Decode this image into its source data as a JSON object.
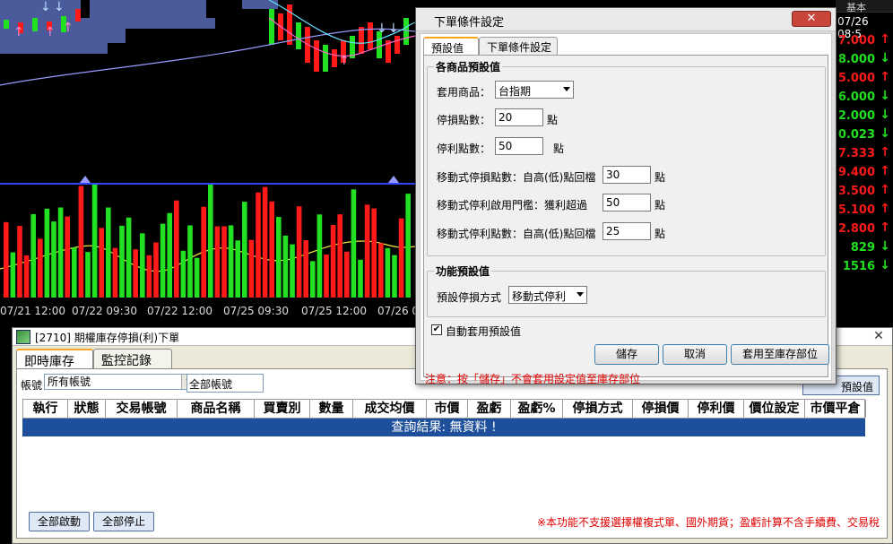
{
  "chart": {
    "time_labels": [
      "07/21 12:00",
      "07/22 09:30",
      "07/22 12:00",
      "07/25 09:30",
      "07/25 12:00",
      "07/26 0"
    ],
    "colors": {
      "up": "#ff1a1a",
      "down": "#22e022",
      "ma1": "#f5e642",
      "ma2": "#ff66cc",
      "ma3": "#66e0ff",
      "ma4": "#9999ff",
      "band": "#4a5a9a",
      "baseline": "#3344ff"
    }
  },
  "quotes": {
    "header": "基本",
    "time": "07/26 08:5",
    "rows": [
      {
        "value": "7.000",
        "dir": "up"
      },
      {
        "value": "8.000",
        "dir": "down"
      },
      {
        "value": "5.000",
        "dir": "up"
      },
      {
        "value": "6.000",
        "dir": "down"
      },
      {
        "value": "2.000",
        "dir": "down"
      },
      {
        "value": "0.023",
        "dir": "down"
      },
      {
        "value": "7.333",
        "dir": "up"
      },
      {
        "value": "9.400",
        "dir": "up"
      },
      {
        "value": "3.500",
        "dir": "up"
      },
      {
        "value": "5.100",
        "dir": "up"
      },
      {
        "value": "2.800",
        "dir": "up"
      },
      {
        "value": "829",
        "dir": "down"
      },
      {
        "value": "1516",
        "dir": "down"
      }
    ]
  },
  "bottom_window": {
    "title": "[2710] 期權庫存停損(利)下單",
    "tabs": [
      "即時庫存",
      "監控記錄"
    ],
    "account_label": "帳號",
    "account_select": "所有帳號",
    "account_name": "全部帳號",
    "default_button": "預設值",
    "columns": [
      "執行",
      "狀態",
      "交易帳號",
      "商品名稱",
      "買賣別",
      "數量",
      "成交均價",
      "市價",
      "盈虧",
      "盈虧%",
      "停損方式",
      "停損價",
      "停利價",
      "價位設定",
      "市價平倉"
    ],
    "result_message": "查詢結果: 無資料 !",
    "start_all": "全部啟動",
    "stop_all": "全部停止",
    "note": "※本功能不支援選擇權複式單、國外期貨；盈虧計算不含手續費、交易稅"
  },
  "dialog": {
    "title": "下單條件設定",
    "close_label": "✕",
    "tabs": [
      "預設值",
      "下單條件設定"
    ],
    "group1_title": "各商品預設值",
    "fields": {
      "product_label": "套用商品：",
      "product_value": "台指期",
      "stop_loss_label": "停損點數：",
      "stop_loss_value": "20",
      "take_profit_label": "停利點數：",
      "take_profit_value": "50",
      "trail_loss_label": "移動式停損點數：自高(低)點回檔",
      "trail_loss_value": "30",
      "trail_trigger_label": "移動式停利啟用門檻：獲利超過",
      "trail_trigger_value": "50",
      "trail_profit_label": "移動式停利點數：自高(低)點回檔",
      "trail_profit_value": "25",
      "unit": "點"
    },
    "group2_title": "功能預設值",
    "method_label": "預設停損方式",
    "method_value": "移動式停利",
    "auto_apply_label": "自動套用預設值",
    "auto_apply_checked": "✔",
    "buttons": {
      "save": "儲存",
      "cancel": "取消",
      "apply": "套用至庫存部位"
    },
    "note": "注意：按「儲存」不會套用設定值至庫存部位"
  }
}
